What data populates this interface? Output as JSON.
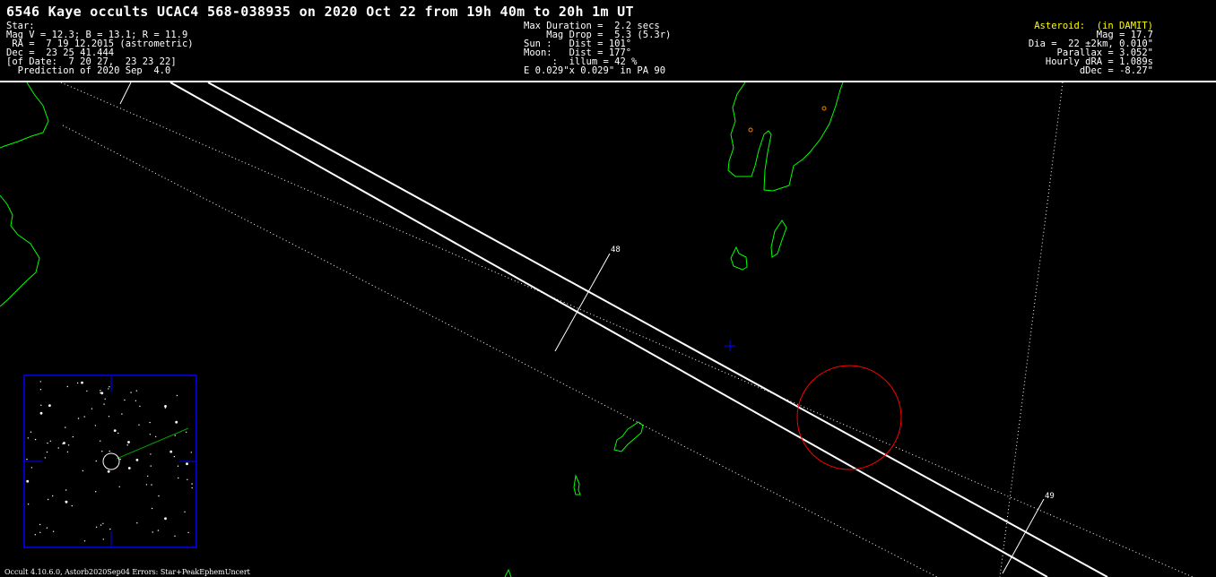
{
  "title": "6546 Kaye occults UCAC4 568-038935 on 2020 Oct 22 from 19h 40m to 20h  1m UT",
  "star": {
    "heading": "Star:",
    "mags": "Mag V = 12.3; B = 13.1; R = 11.9",
    "ra": " RA =  7 19 12.2015 (astrometric)",
    "dec": "Dec =  23 25 41.444",
    "of_date": "[of Date:  7 20 27,  23 23 22]",
    "prediction": "  Prediction of 2020 Sep  4.0"
  },
  "event": {
    "max_duration": "Max Duration =  2.2 secs",
    "mag_drop": "    Mag Drop =  5.3 (5.3r)",
    "sun": "Sun :   Dist = 101°",
    "moon": "Moon:   Dist = 177°",
    "illum": "     :  illum = 42 %",
    "ellipse": "E 0.029\"x 0.029\" in PA 90"
  },
  "asteroid": {
    "heading": "Asteroid:  (in DAMIT)",
    "mag": "Mag = 17.7",
    "dia": "Dia =  22 ±2km, 0.010\"",
    "parallax": "Parallax = 3.052\"",
    "hourly_dra": "Hourly dRA = 1.089s",
    "ddec": "dDec = -8.27\""
  },
  "ticks": {
    "t48": "48",
    "t49": "49"
  },
  "footer": "Occult 4.10.6.0, Astorb2020Sep04  Errors: Star+PeakEphemUncert",
  "colors": {
    "coastline": "#00ff00",
    "path": "#ffffff",
    "shadow_circle": "#ff0000",
    "center_cross": "#0000ff",
    "finder_frame": "#0000ff",
    "asteroid_label": "#ffff00"
  }
}
